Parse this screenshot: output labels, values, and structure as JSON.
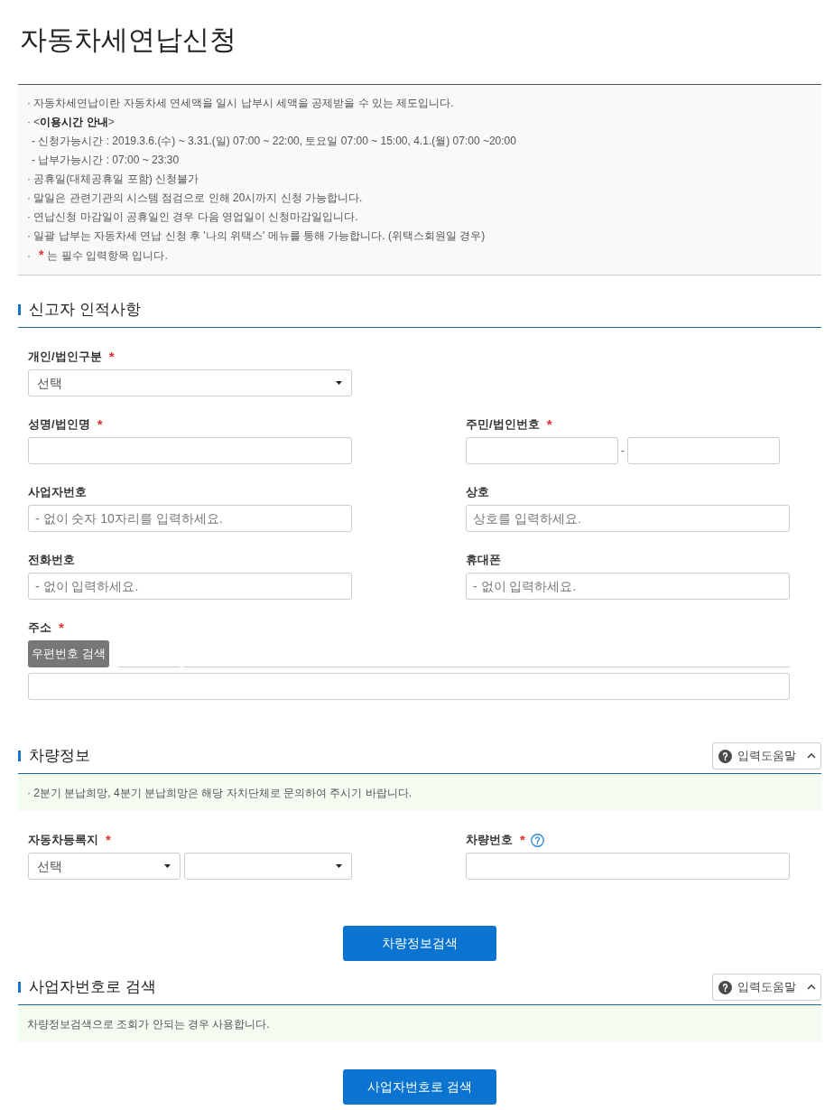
{
  "page": {
    "title": "자동차세연납신청"
  },
  "notice": {
    "items": [
      {
        "kind": "bullet",
        "text": "· 자동차세연납이란 자동차세 연세액을 일시 납부시 세액을 공제받을 수 있는 제도입니다."
      },
      {
        "kind": "bullet",
        "text": "· <**이용시간 안내**>"
      },
      {
        "kind": "sub",
        "text": "- 신청가능시간 : 2019.3.6.(수) ~ 3.31.(일) 07:00 ~ 22:00, 토요일 07:00 ~ 15:00, 4.1.(월) 07:00 ~20:00"
      },
      {
        "kind": "sub",
        "text": "- 납부가능시간 : 07:00 ~ 23:30"
      },
      {
        "kind": "bullet",
        "text": "· 공휴일(대체공휴일 포함) 신청불가"
      },
      {
        "kind": "bullet",
        "text": "· 말일은 관련기관의 시스템 점검으로 인해 20시까지 신청 가능합니다."
      },
      {
        "kind": "bullet",
        "text": "· 연납신청 마감일이 공휴일인 경우 다음 영업일이 신청마감일입니다."
      },
      {
        "kind": "bullet",
        "text": "· 일괄 납부는 자동차세 연납 신청 후 '나의 위택스' 메뉴를 통해 가능합니다. (위택스회원일 경우)"
      },
      {
        "kind": "required_note",
        "bullet": "·",
        "star": "*",
        "text": "는 필수 입력항목 입니다."
      }
    ]
  },
  "sections": [
    {
      "title": "신고자 인적사항",
      "rows": [
        [
          {
            "label": "개인/법인구분",
            "mark": "*",
            "kind": "select",
            "value": "선택"
          }
        ],
        [
          {
            "label": "성명/법인명",
            "mark": "*",
            "kind": "input"
          },
          {
            "label": "주민/법인번호",
            "mark": "*",
            "kind": "split_input",
            "separator": "-"
          }
        ],
        [
          {
            "label": "사업자번호",
            "kind": "input",
            "placeholder": "- 없이 숫자 10자리를 입력하세요."
          },
          {
            "label": "상호",
            "kind": "input",
            "placeholder": "상호를 입력하세요."
          }
        ],
        [
          {
            "label": "전화번호",
            "kind": "input",
            "placeholder": "- 없이 입력하세요."
          },
          {
            "label": "휴대폰",
            "kind": "input",
            "placeholder": "- 없이 입력하세요."
          }
        ],
        [
          {
            "label": "주소",
            "mark": "*",
            "kind": "address",
            "button": "우편번호 검색"
          }
        ]
      ]
    },
    {
      "title": "차량정보",
      "help_button": {
        "label": "입력도움말",
        "expanded": true
      },
      "notice": "· 2분기 분납희망, 4분기 분납희망은 해당 자치단체로 문의하여 주시기 바랍니다.",
      "rows": [
        [
          {
            "label": "자동차등록지",
            "mark": "*",
            "kind": "select_pair",
            "value": "선택"
          },
          {
            "label": "차량번호",
            "mark": "*",
            "info_icon": true,
            "kind": "input"
          }
        ]
      ],
      "button": "차량정보검색"
    },
    {
      "title": "사업자번호로 검색",
      "help_button": {
        "label": "입력도움말",
        "expanded": true
      },
      "notice": "차량정보검색으로 조회가 안되는 경우 사용합니다.",
      "button": "사업자번호로 검색"
    }
  ]
}
